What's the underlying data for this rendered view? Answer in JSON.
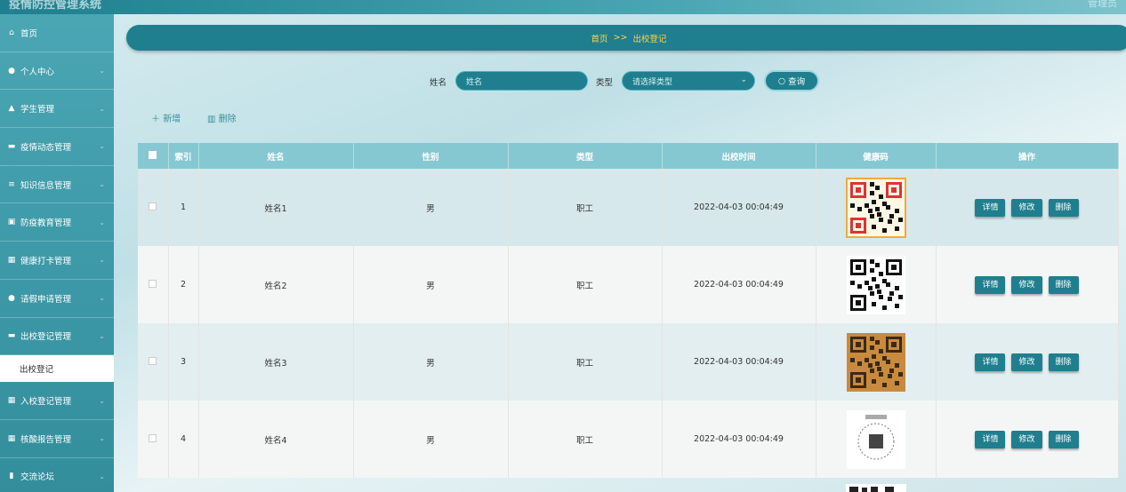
{
  "topbar": {
    "title": "疫情防控管理系统",
    "user": "管理员"
  },
  "sidebar": {
    "items": [
      {
        "icon": "home-icon",
        "glyph": "⌂",
        "label": "首页"
      },
      {
        "icon": "user-icon",
        "glyph": "●",
        "label": "个人中心"
      },
      {
        "icon": "thumb-icon",
        "glyph": "▲",
        "label": "学生管理"
      },
      {
        "icon": "monitor-icon",
        "glyph": "▬",
        "label": "疫情动态管理"
      },
      {
        "icon": "list-icon",
        "glyph": "≡",
        "label": "知识信息管理"
      },
      {
        "icon": "doc-icon",
        "glyph": "▣",
        "label": "防疫教育管理"
      },
      {
        "icon": "grid-icon",
        "glyph": "▦",
        "label": "健康打卡管理"
      },
      {
        "icon": "person-icon",
        "glyph": "●",
        "label": "请假申请管理"
      },
      {
        "icon": "monitor-icon",
        "glyph": "▬",
        "label": "出校登记管理"
      }
    ],
    "active_sub": "出校登记",
    "items_after": [
      {
        "icon": "grid-icon",
        "glyph": "▦",
        "label": "入校登记管理"
      },
      {
        "icon": "grid-icon",
        "glyph": "▦",
        "label": "核酸报告管理"
      },
      {
        "icon": "chart-icon",
        "glyph": "▮",
        "label": "交流论坛"
      }
    ]
  },
  "breadcrumb": {
    "home": "首页",
    "sep": ">>",
    "current": "出校登记"
  },
  "search": {
    "name_label": "姓名",
    "name_placeholder": "姓名",
    "type_label": "类型",
    "type_placeholder": "请选择类型",
    "query_label": "查询"
  },
  "actions": {
    "add": "新增",
    "delete": "删除"
  },
  "table": {
    "headers": [
      "索引",
      "姓名",
      "性别",
      "类型",
      "出校时间",
      "健康码",
      "操作"
    ],
    "rows": [
      {
        "index": "1",
        "name": "姓名1",
        "gender": "男",
        "type": "职工",
        "time": "2022-04-03 00:04:49"
      },
      {
        "index": "2",
        "name": "姓名2",
        "gender": "男",
        "type": "职工",
        "time": "2022-04-03 00:04:49"
      },
      {
        "index": "3",
        "name": "姓名3",
        "gender": "男",
        "type": "职工",
        "time": "2022-04-03 00:04:49"
      },
      {
        "index": "4",
        "name": "姓名4",
        "gender": "男",
        "type": "职工",
        "time": "2022-04-03 00:04:49"
      }
    ],
    "row_buttons": {
      "detail": "详情",
      "edit": "修改",
      "delete": "删除"
    }
  },
  "colors": {
    "primary": "#1f7f8e",
    "header": "#86c8d2",
    "crumb_text": "#ffd24a"
  }
}
